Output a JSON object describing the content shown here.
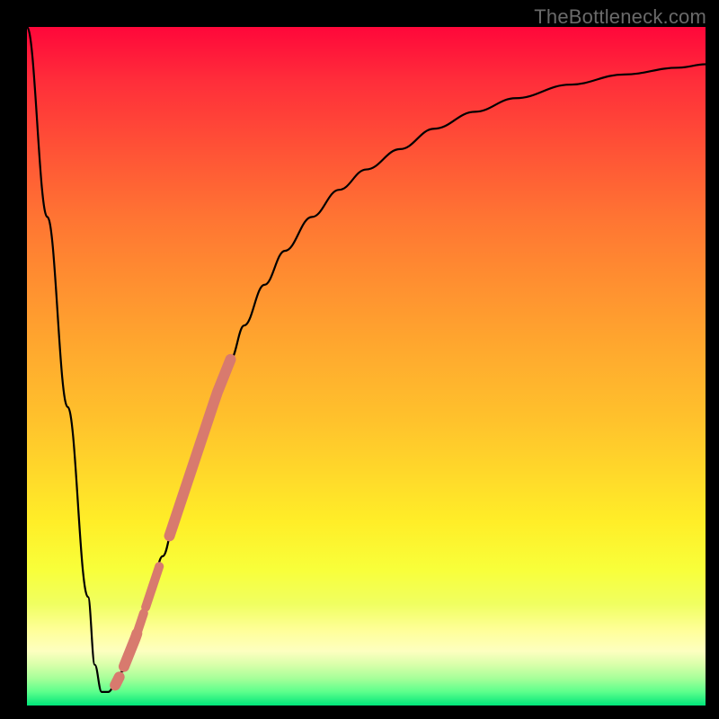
{
  "attribution": "TheBottleneck.com",
  "colors": {
    "frame": "#000000",
    "curve": "#000000",
    "marker": "#d87a6e",
    "gradient_top": "#ff073a",
    "gradient_bottom": "#00e57a"
  },
  "chart_data": {
    "type": "line",
    "title": "",
    "xlabel": "",
    "ylabel": "",
    "xlim": [
      0,
      100
    ],
    "ylim": [
      0,
      100
    ],
    "grid": false,
    "legend": false,
    "series": [
      {
        "name": "bottleneck-curve",
        "x": [
          0,
          3,
          6,
          9,
          10,
          11,
          12,
          13,
          14,
          16,
          18,
          20,
          22,
          24,
          26,
          28,
          30,
          32,
          35,
          38,
          42,
          46,
          50,
          55,
          60,
          66,
          72,
          80,
          88,
          96,
          100
        ],
        "y": [
          100,
          72,
          44,
          16,
          6,
          2,
          2,
          3,
          5,
          10,
          16,
          22,
          28,
          34,
          40,
          46,
          51,
          56,
          62,
          67,
          72,
          76,
          79,
          82,
          85,
          87.5,
          89.5,
          91.5,
          93,
          94,
          94.5
        ]
      }
    ],
    "highlight_segments": [
      {
        "x_start": 21,
        "x_end": 30,
        "width": 12
      },
      {
        "x_start": 17.5,
        "x_end": 19.5,
        "width": 10
      },
      {
        "x_start": 16.2,
        "x_end": 17.2,
        "width": 10
      },
      {
        "x_start": 14.3,
        "x_end": 16.2,
        "width": 12
      },
      {
        "x_start": 13.0,
        "x_end": 13.6,
        "width": 12
      }
    ]
  }
}
